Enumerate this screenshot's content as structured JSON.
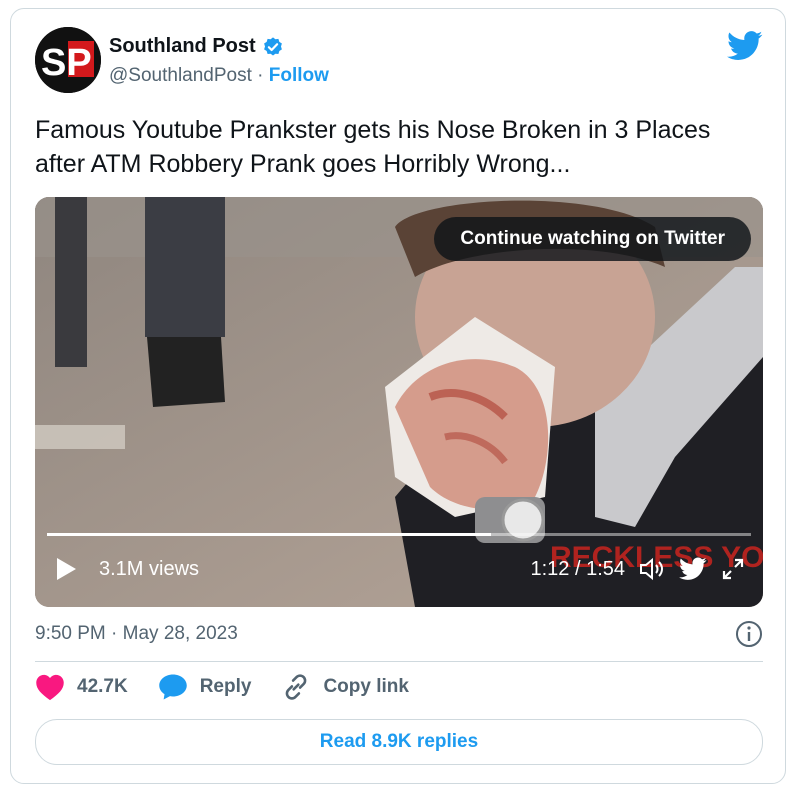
{
  "account": {
    "display_name": "Southland Post",
    "handle": "@SouthlandPost",
    "separator": "·",
    "follow_label": "Follow",
    "logo_text": "SP"
  },
  "tweet": {
    "text": "Famous Youtube Prankster gets his Nose Broken in 3 Places after ATM Robbery Prank goes Horribly Wrong...",
    "timestamp": "9:50 PM · May 28, 2023"
  },
  "video": {
    "continue_label": "Continue watching on Twitter",
    "views": "3.1M views",
    "time": "1:12 / 1:54",
    "progress": 0.63,
    "watermark": "RECKLESS YOUTH"
  },
  "actions": {
    "likes": "42.7K",
    "reply_label": "Reply",
    "copy_label": "Copy link",
    "read_replies": "Read 8.9K replies"
  },
  "colors": {
    "accent": "#1d9bf0",
    "like": "#f91880",
    "text": "#0f1419",
    "secondary": "#536471"
  },
  "icons": [
    "verified-badge-icon",
    "twitter-bird-icon",
    "play-icon",
    "volume-icon",
    "fullscreen-icon",
    "info-icon",
    "heart-icon",
    "reply-bubble-icon",
    "link-icon"
  ]
}
